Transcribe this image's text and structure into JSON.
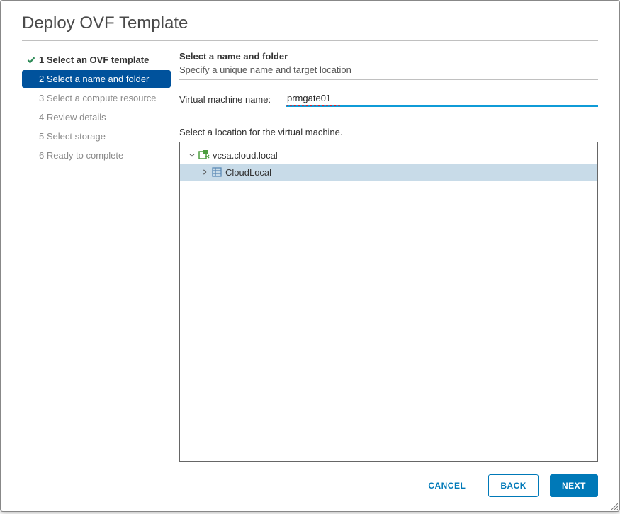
{
  "title": "Deploy OVF Template",
  "steps": [
    {
      "label": "1 Select an OVF template",
      "state": "completed"
    },
    {
      "label": "2 Select a name and folder",
      "state": "active"
    },
    {
      "label": "3 Select a compute resource",
      "state": "pending"
    },
    {
      "label": "4 Review details",
      "state": "pending"
    },
    {
      "label": "5 Select storage",
      "state": "pending"
    },
    {
      "label": "6 Ready to complete",
      "state": "pending"
    }
  ],
  "section": {
    "heading": "Select a name and folder",
    "subheading": "Specify a unique name and target location",
    "vm_name_label": "Virtual machine name:",
    "vm_name_value": "prmgate01",
    "location_label": "Select a location for the virtual machine."
  },
  "tree": {
    "root": {
      "label": "vcsa.cloud.local",
      "icon": "vcenter-icon",
      "expanded": true
    },
    "child": {
      "label": "CloudLocal",
      "icon": "datacenter-icon",
      "expanded": false,
      "selected": true
    }
  },
  "footer": {
    "cancel": "CANCEL",
    "back": "BACK",
    "next": "NEXT"
  }
}
